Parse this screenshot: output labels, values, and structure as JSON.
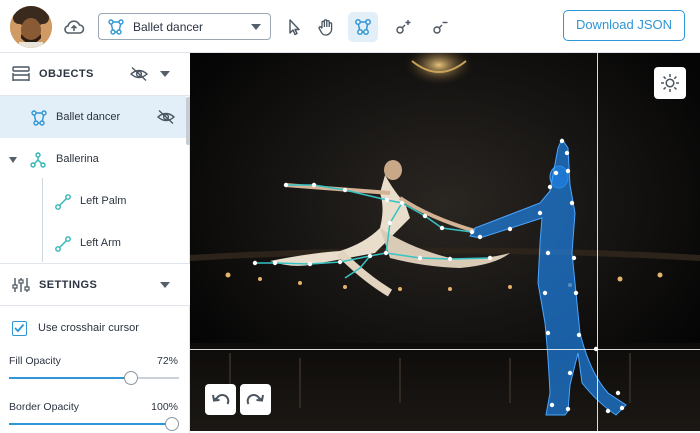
{
  "header": {
    "dataset_select": {
      "value": "Ballet dancer"
    },
    "download_label": "Download JSON",
    "tools": [
      "pointer-tool",
      "pan-hand-tool",
      "skeleton-tool",
      "add-point-tool",
      "remove-point-tool"
    ],
    "active_tool": "skeleton-tool"
  },
  "sidebar": {
    "objects_section": {
      "title": "OBJECTS",
      "items": [
        {
          "label": "Ballet dancer",
          "icon": "skeleton-icon",
          "selected": true
        },
        {
          "label": "Ballerina",
          "icon": "skeleton-group-icon",
          "expanded": true
        },
        {
          "label": "Left Palm",
          "icon": "bone-icon"
        },
        {
          "label": "Left Arm",
          "icon": "bone-icon"
        }
      ]
    },
    "settings_section": {
      "title": "SETTINGS",
      "crosshair": {
        "label": "Use crosshair cursor",
        "checked": true
      },
      "fill_opacity": {
        "label": "Fill Opacity",
        "value": "72%",
        "fraction": 0.72
      },
      "border_opacity": {
        "label": "Border Opacity",
        "value": "100%",
        "fraction": 1.0
      }
    }
  },
  "canvas": {
    "controls": [
      "brightness-icon",
      "undo-icon",
      "redo-icon"
    ],
    "crosshair": true
  },
  "colors": {
    "accent": "#2e96d6",
    "ballerina_skeleton": "#3ac6c6",
    "dancer_fill": "#1f7fe0",
    "selection_bg": "#e2eef8"
  }
}
